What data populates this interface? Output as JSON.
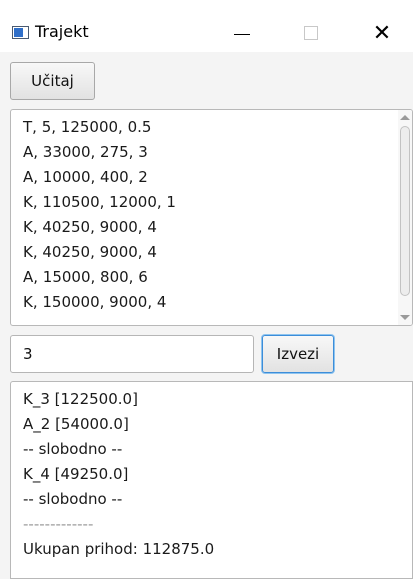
{
  "window": {
    "title": "Trajekt",
    "close_glyph": "✕"
  },
  "toolbar": {
    "load_label": "Učitaj"
  },
  "list": {
    "items": [
      "T, 5, 125000, 0.5",
      "A, 33000, 275, 3",
      "A, 10000, 400, 2",
      "K, 110500, 12000, 1",
      "K, 40250, 9000, 4",
      "K, 40250, 9000, 4",
      "A, 15000, 800, 6",
      "K, 150000, 9000, 4"
    ]
  },
  "input": {
    "value": "3"
  },
  "report": {
    "label": "Izvezi"
  },
  "output": {
    "lines": [
      "K_3 [122500.0]",
      "A_2 [54000.0]",
      "-- slobodno --",
      "K_4 [49250.0]",
      "-- slobodno --",
      "-------------",
      "Ukupan prihod: 112875.0"
    ]
  }
}
